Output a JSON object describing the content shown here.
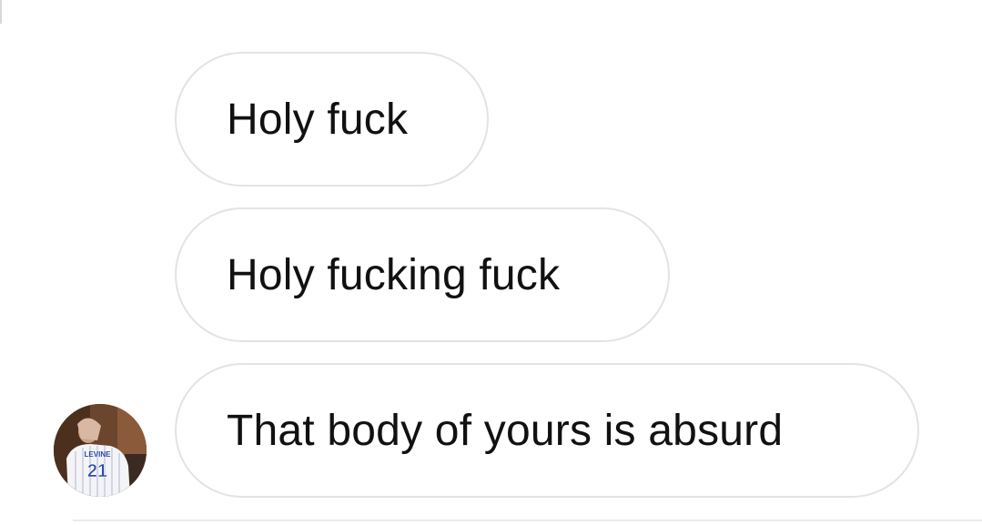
{
  "conversation": {
    "messages": [
      {
        "text": "Holy fuck"
      },
      {
        "text": "Holy fucking fuck"
      },
      {
        "text": "That body of yours is absurd"
      }
    ],
    "sender": {
      "avatar_jersey_name": "LEVINE",
      "avatar_jersey_number": "21"
    }
  },
  "colors": {
    "bubble_border": "#e3e3e3",
    "bubble_background": "#ffffff",
    "text": "#111111",
    "jersey_number": "#2c4aa8"
  }
}
